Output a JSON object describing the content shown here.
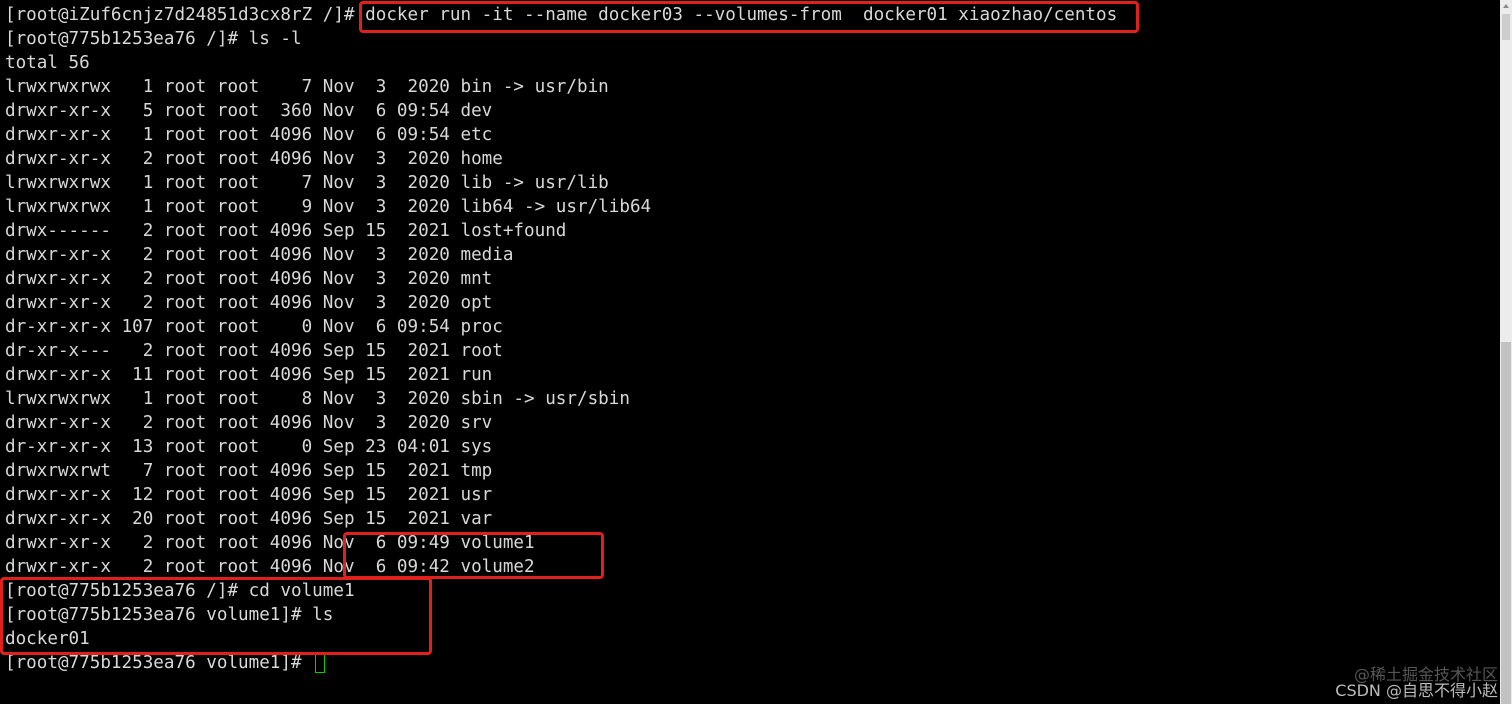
{
  "terminal": {
    "lines": [
      "[root@iZuf6cnjz7d24851d3cx8rZ /]# docker run -it --name docker03 --volumes-from  docker01 xiaozhao/centos",
      "[root@775b1253ea76 /]# ls -l",
      "total 56",
      "lrwxrwxrwx   1 root root    7 Nov  3  2020 bin -> usr/bin",
      "drwxr-xr-x   5 root root  360 Nov  6 09:54 dev",
      "drwxr-xr-x   1 root root 4096 Nov  6 09:54 etc",
      "drwxr-xr-x   2 root root 4096 Nov  3  2020 home",
      "lrwxrwxrwx   1 root root    7 Nov  3  2020 lib -> usr/lib",
      "lrwxrwxrwx   1 root root    9 Nov  3  2020 lib64 -> usr/lib64",
      "drwx------   2 root root 4096 Sep 15  2021 lost+found",
      "drwxr-xr-x   2 root root 4096 Nov  3  2020 media",
      "drwxr-xr-x   2 root root 4096 Nov  3  2020 mnt",
      "drwxr-xr-x   2 root root 4096 Nov  3  2020 opt",
      "dr-xr-xr-x 107 root root    0 Nov  6 09:54 proc",
      "dr-xr-x---   2 root root 4096 Sep 15  2021 root",
      "drwxr-xr-x  11 root root 4096 Sep 15  2021 run",
      "lrwxrwxrwx   1 root root    8 Nov  3  2020 sbin -> usr/sbin",
      "drwxr-xr-x   2 root root 4096 Nov  3  2020 srv",
      "dr-xr-xr-x  13 root root    0 Sep 23 04:01 sys",
      "drwxrwxrwt   7 root root 4096 Sep 15  2021 tmp",
      "drwxr-xr-x  12 root root 4096 Sep 15  2021 usr",
      "drwxr-xr-x  20 root root 4096 Sep 15  2021 var",
      "drwxr-xr-x   2 root root 4096 Nov  6 09:49 volume1",
      "drwxr-xr-x   2 root root 4096 Nov  6 09:42 volume2",
      "[root@775b1253ea76 /]# cd volume1",
      "[root@775b1253ea76 volume1]# ls",
      "docker01",
      "[root@775b1253ea76 volume1]# "
    ],
    "cursor_color": "#00d000",
    "highlight_color": "#e0201c",
    "background_color": "#000000",
    "text_color": "#d8d8d8"
  },
  "watermark": {
    "line1": "@稀土掘金技术社区",
    "line2": "CSDN @自思不得小赵"
  }
}
